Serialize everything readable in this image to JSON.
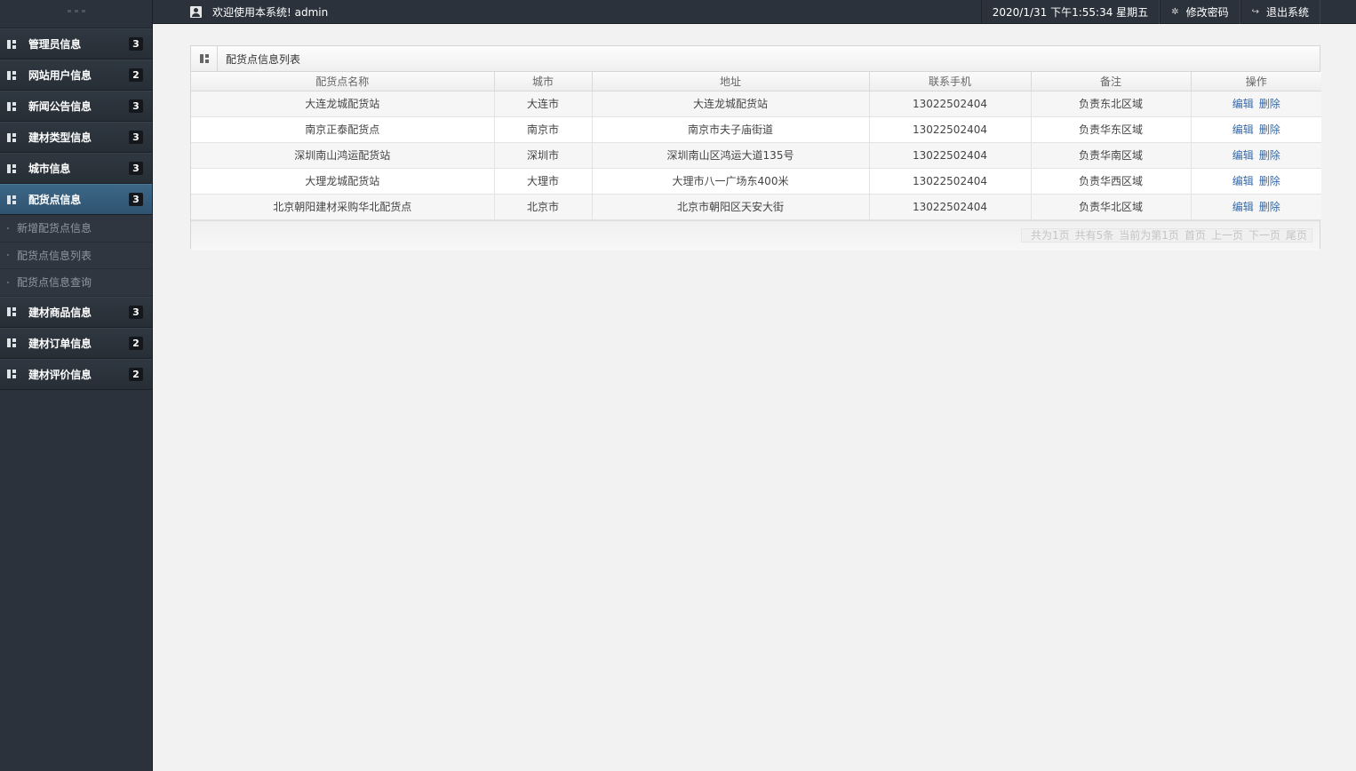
{
  "topbar": {
    "welcome": "欢迎使用本系统! admin",
    "datetime": "2020/1/31 下午1:55:34 星期五",
    "change_password": "修改密码",
    "logout": "退出系统"
  },
  "sidebar": {
    "items": [
      {
        "label": "管理员信息",
        "count": "3"
      },
      {
        "label": "网站用户信息",
        "count": "2"
      },
      {
        "label": "新闻公告信息",
        "count": "3"
      },
      {
        "label": "建材类型信息",
        "count": "3"
      },
      {
        "label": "城市信息",
        "count": "3"
      },
      {
        "label": "配货点信息",
        "count": "3"
      },
      {
        "label": "建材商品信息",
        "count": "3"
      },
      {
        "label": "建材订单信息",
        "count": "2"
      },
      {
        "label": "建材评价信息",
        "count": "2"
      }
    ],
    "subitems": [
      "新增配货点信息",
      "配货点信息列表",
      "配货点信息查询"
    ]
  },
  "panel": {
    "title": "配货点信息列表",
    "columns": [
      "配货点名称",
      "城市",
      "地址",
      "联系手机",
      "备注",
      "操作"
    ],
    "rows": [
      {
        "name": "大连龙城配货站",
        "city": "大连市",
        "address": "大连龙城配货站",
        "phone": "13022502404",
        "remark": "负责东北区域"
      },
      {
        "name": "南京正泰配货点",
        "city": "南京市",
        "address": "南京市夫子庙街道",
        "phone": "13022502404",
        "remark": "负责华东区域"
      },
      {
        "name": "深圳南山鸿运配货站",
        "city": "深圳市",
        "address": "深圳南山区鸿运大道135号",
        "phone": "13022502404",
        "remark": "负责华南区域"
      },
      {
        "name": "大理龙城配货站",
        "city": "大理市",
        "address": "大理市八一广场东400米",
        "phone": "13022502404",
        "remark": "负责华西区域"
      },
      {
        "name": "北京朝阳建材采购华北配货点",
        "city": "北京市",
        "address": "北京市朝阳区天安大街",
        "phone": "13022502404",
        "remark": "负责华北区域"
      }
    ],
    "edit_label": "编辑",
    "delete_label": "删除",
    "pager": {
      "total_pages": "共为1页",
      "total_items": "共有5条",
      "current": "当前为第1页",
      "first": "首页",
      "prev": "上一页",
      "next": "下一页",
      "last": "尾页"
    }
  }
}
